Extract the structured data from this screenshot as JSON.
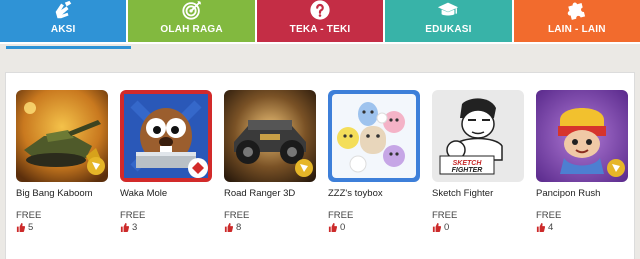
{
  "tabs": [
    {
      "label": "AKSI",
      "icon": "hands-icon",
      "color": "#2f93d6",
      "active": true
    },
    {
      "label": "OLAH RAGA",
      "icon": "target-icon",
      "color": "#82b93f",
      "active": false
    },
    {
      "label": "TEKA - TEKI",
      "icon": "question-icon",
      "color": "#c42d45",
      "active": false
    },
    {
      "label": "EDUKASI",
      "icon": "graduation-cap-icon",
      "color": "#38b3a8",
      "active": false
    },
    {
      "label": "LAIN - LAIN",
      "icon": "puzzle-icon",
      "color": "#f26b2d",
      "active": false
    }
  ],
  "games": [
    {
      "title": "Big Bang Kaboom",
      "price": "FREE",
      "likes": "5"
    },
    {
      "title": "Waka Mole",
      "price": "FREE",
      "likes": "3"
    },
    {
      "title": "Road Ranger 3D",
      "price": "FREE",
      "likes": "8"
    },
    {
      "title": "ZZZ's toybox",
      "price": "FREE",
      "likes": "0"
    },
    {
      "title": "Sketch Fighter",
      "price": "FREE",
      "likes": "0"
    },
    {
      "title": "Pancipon Rush",
      "price": "FREE",
      "likes": "4"
    }
  ],
  "artwork_text": {
    "sketch_fighter_logo": "SKETCH FIGHTER"
  }
}
